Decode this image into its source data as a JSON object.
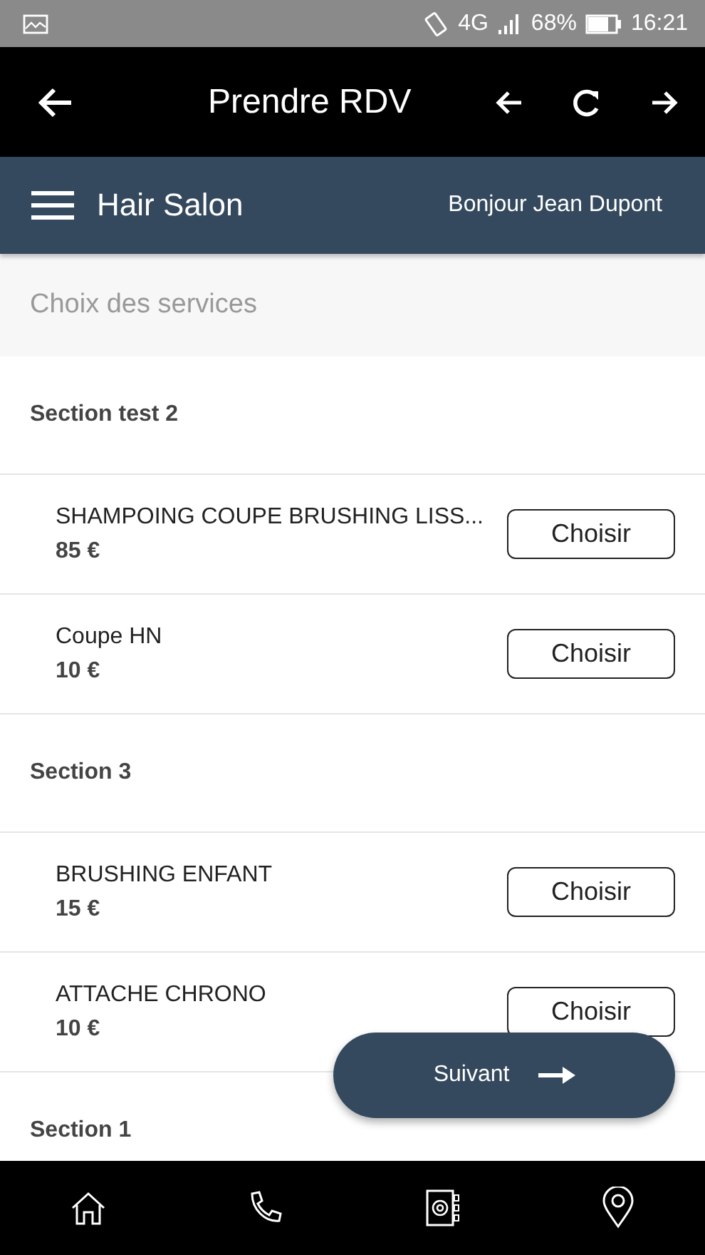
{
  "status_bar": {
    "network": "4G",
    "battery": "68%",
    "time": "16:21"
  },
  "top_bar": {
    "title": "Prendre RDV"
  },
  "header": {
    "brand": "Hair Salon",
    "greeting": "Bonjour Jean Dupont"
  },
  "page_title": "Choix des services",
  "sections": [
    {
      "title": "Section test 2",
      "services": [
        {
          "name": "SHAMPOING COUPE BRUSHING LISS...",
          "price": "85 €",
          "button": "Choisir"
        },
        {
          "name": "Coupe HN",
          "price": "10 €",
          "button": "Choisir"
        }
      ]
    },
    {
      "title": "Section 3",
      "services": [
        {
          "name": "BRUSHING ENFANT",
          "price": "15 €",
          "button": "Choisir"
        },
        {
          "name": "ATTACHE CHRONO",
          "price": "10 €",
          "button": "Choisir"
        }
      ]
    },
    {
      "title": "Section 1"
    }
  ],
  "next_button": "Suivant",
  "bottom_nav": [
    {
      "kind": "home"
    },
    {
      "kind": "phone"
    },
    {
      "kind": "contacts"
    },
    {
      "kind": "location"
    }
  ]
}
